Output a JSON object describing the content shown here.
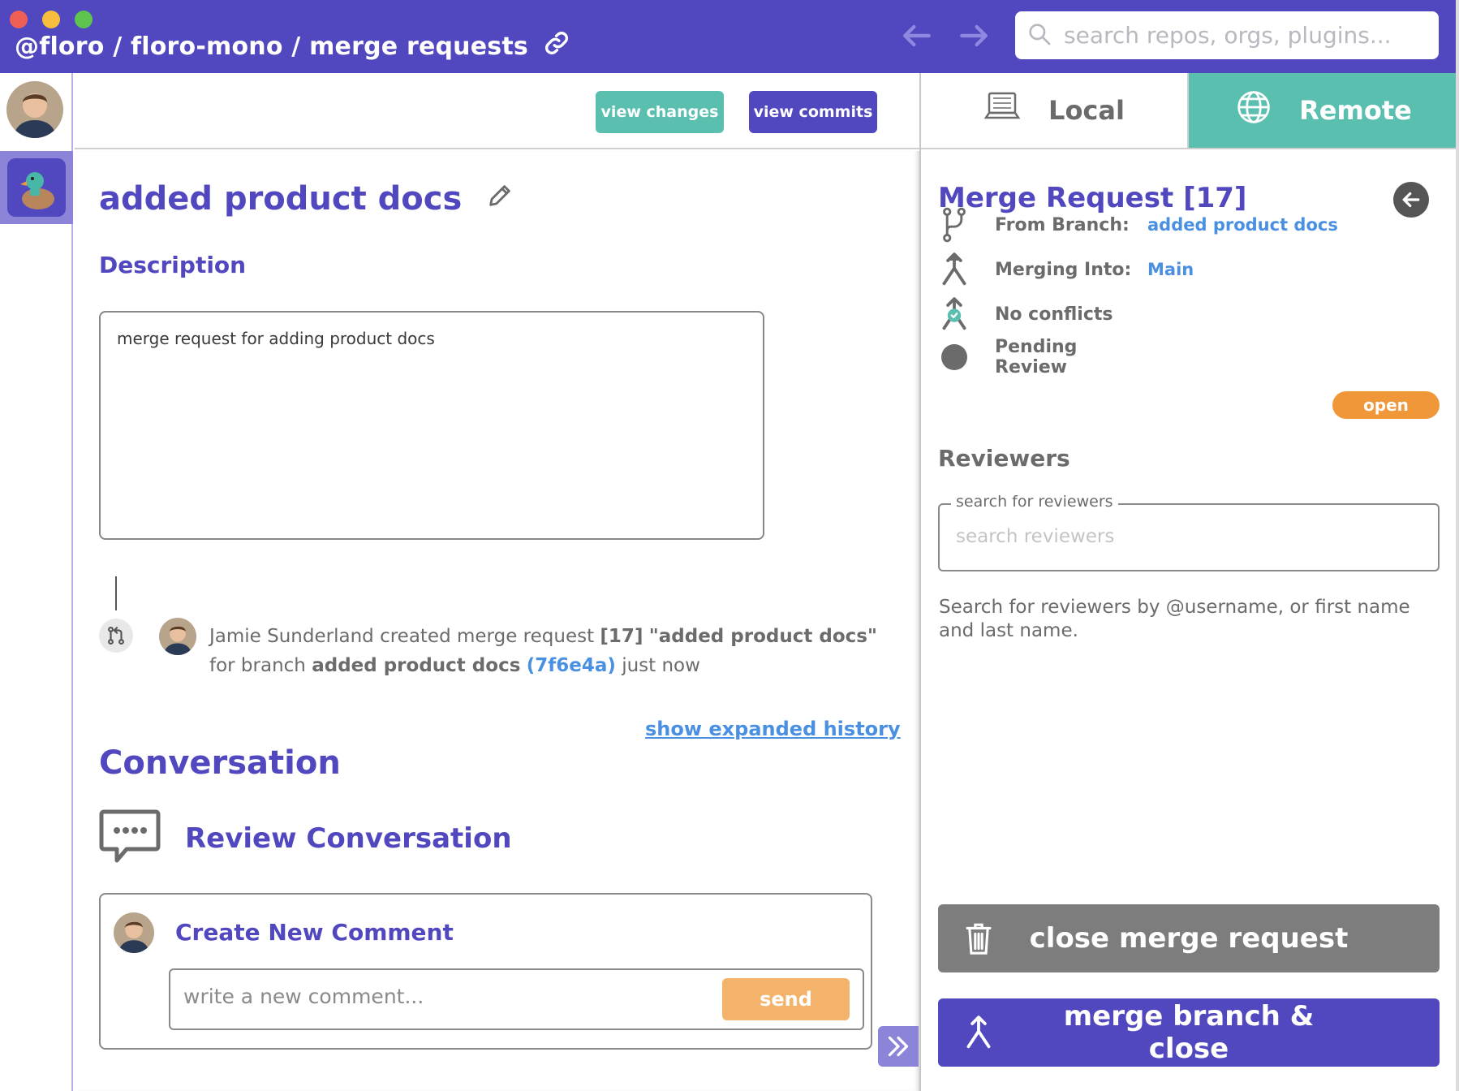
{
  "window": {
    "breadcrumb": "@floro / floro-mono / merge requests",
    "search_placeholder": "search repos, orgs, plugins..."
  },
  "header": {
    "view_changes_label": "view changes",
    "view_commits_label": "view commits"
  },
  "tabs": {
    "local_label": "Local",
    "remote_label": "Remote",
    "active": "Remote"
  },
  "merge_request": {
    "title": "added product docs",
    "description_label": "Description",
    "description": "merge request for adding product docs"
  },
  "history": {
    "author": "Jamie Sunderland",
    "action": "created merge request",
    "mr_number": "[17]",
    "mr_title": "\"added product docs\"",
    "for_branch_text": "for branch",
    "branch": "added product docs",
    "sha": "(7f6e4a)",
    "time": "just now",
    "expand_link": "show expanded history"
  },
  "conversation": {
    "title": "Conversation",
    "review_title": "Review Conversation",
    "new_comment_title": "Create New Comment",
    "comment_placeholder": "write a new comment...",
    "send_label": "send"
  },
  "panel": {
    "title": "Merge Request [17]",
    "from_branch_label": "From Branch:",
    "from_branch_value": "added product docs",
    "merging_into_label": "Merging Into:",
    "merging_into_value": "Main",
    "conflicts_label": "No conflicts",
    "status_label": "Pending Review",
    "status_badge": "open",
    "reviewers_label": "Reviewers",
    "reviewers_legend": "search for reviewers",
    "reviewers_placeholder": "search reviewers",
    "reviewers_help": "Search for reviewers by @username, or first name and last name.",
    "close_button": "close merge request",
    "merge_button": "merge branch & close"
  },
  "colors": {
    "brand_purple": "#5147be",
    "teal": "#5bbfb0",
    "link_blue": "#4a90e2",
    "orange": "#f0973a",
    "send_orange": "#f3b36a",
    "gray_button": "#7d7d7d"
  },
  "icons": [
    "link-icon",
    "back-arrow-icon",
    "forward-arrow-icon",
    "search-icon",
    "pencil-icon",
    "merge-request-icon",
    "chat-bubble-icon",
    "laptop-icon",
    "globe-icon",
    "branch-icon",
    "merge-icon",
    "no-conflicts-icon",
    "status-dot-icon",
    "circle-back-icon",
    "trash-icon",
    "double-chevron-right-icon"
  ]
}
